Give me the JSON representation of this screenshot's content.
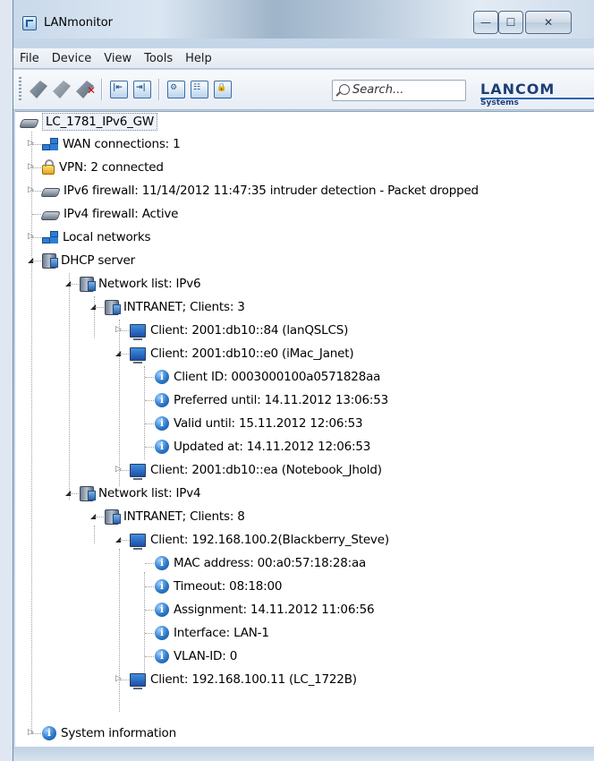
{
  "window": {
    "title": "LANmonitor",
    "controls": {
      "minimize": "—",
      "maximize": "☐",
      "close": "✕"
    }
  },
  "menubar": [
    "File",
    "Device",
    "View",
    "Tools",
    "Help"
  ],
  "toolbar": {
    "buttons": [
      "connect-device-icon",
      "search-device-icon",
      "delete-device-icon",
      "left-arrow-icon",
      "right-arrow-icon",
      "settings-icon",
      "table-icon",
      "lock-icon"
    ],
    "search_placeholder": "Search...",
    "logo": {
      "main": "LANCOM",
      "sub": "Systems"
    }
  },
  "tree": {
    "root": "LC_1781_IPv6_GW",
    "items": [
      {
        "label": "WAN connections: 1",
        "icon": "network-icon"
      },
      {
        "label": "VPN: 2 connected",
        "icon": "lock-icon"
      },
      {
        "label": "IPv6 firewall: 11/14/2012 11:47:35 intruder detection - Packet dropped",
        "icon": "router-icon"
      },
      {
        "label": "IPv4 firewall: Active",
        "icon": "router-icon"
      },
      {
        "label": "Local networks",
        "icon": "network-icon"
      },
      {
        "label": "DHCP server",
        "icon": "server-icon"
      },
      {
        "label": "Network list: IPv6",
        "icon": "server-icon"
      },
      {
        "label": "INTRANET; Clients: 3",
        "icon": "server-icon"
      },
      {
        "label": "Client: 2001:db10::84 (lanQSLCS)",
        "icon": "monitor-icon"
      },
      {
        "label": "Client: 2001:db10::e0 (iMac_Janet)",
        "icon": "monitor-icon"
      },
      {
        "label": "Client ID: 0003000100a0571828aa",
        "icon": "info-icon"
      },
      {
        "label": "Preferred until: 14.11.2012 13:06:53",
        "icon": "info-icon"
      },
      {
        "label": "Valid until: 15.11.2012 12:06:53",
        "icon": "info-icon"
      },
      {
        "label": "Updated at: 14.11.2012 12:06:53",
        "icon": "info-icon"
      },
      {
        "label": "Client: 2001:db10::ea (Notebook_Jhold)",
        "icon": "monitor-icon"
      },
      {
        "label": "Network list: IPv4",
        "icon": "server-icon"
      },
      {
        "label": "INTRANET; Clients: 8",
        "icon": "server-icon"
      },
      {
        "label": "Client: 192.168.100.2(Blackberry_Steve)",
        "icon": "monitor-icon"
      },
      {
        "label": "MAC address: 00:a0:57:18:28:aa",
        "icon": "info-icon"
      },
      {
        "label": "Timeout: 08:18:00",
        "icon": "info-icon"
      },
      {
        "label": "Assignment: 14.11.2012 11:06:56",
        "icon": "info-icon"
      },
      {
        "label": "Interface: LAN-1",
        "icon": "info-icon"
      },
      {
        "label": "VLAN-ID: 0",
        "icon": "info-icon"
      },
      {
        "label": "Client: 192.168.100.11 (LC_1722B)",
        "icon": "monitor-icon"
      },
      {
        "label": "System information",
        "icon": "info-icon"
      }
    ]
  }
}
